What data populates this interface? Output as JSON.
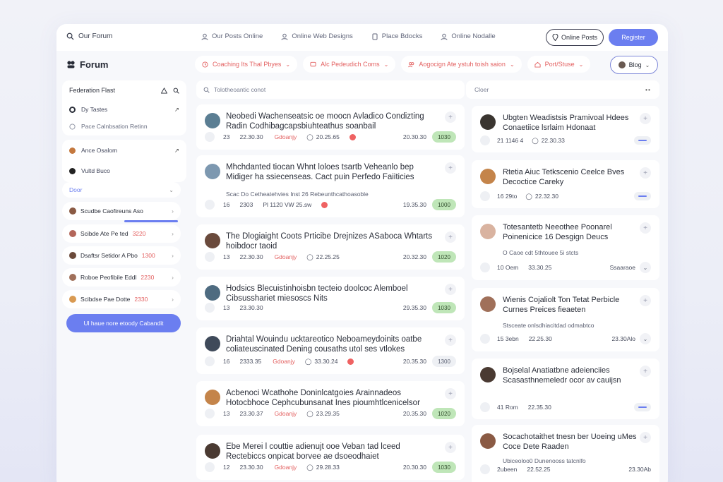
{
  "topbar": {
    "brand": "Our Forum",
    "nav": [
      "Our Posts Online",
      "Online Web Designs",
      "Place Bdocks",
      "Online Nodalle"
    ],
    "outline_btn": "Online Posts",
    "primary_btn": "Register"
  },
  "page": {
    "title": "Forum"
  },
  "filters": [
    {
      "label": "Coaching Its Thal Pbyes"
    },
    {
      "label": "Alc Pedeudich Coms"
    },
    {
      "label": "Aogocign Ate ystuh toish saion"
    },
    {
      "label": "Port/Stuse"
    }
  ],
  "blog_btn": "Blog",
  "sidebar": {
    "header": "Federation Flast",
    "row1": "Dy Tastes",
    "row1_sub": "Pace Calnbsation Retinn",
    "row2": "Ance Osalom",
    "row3": "Vultd Buco",
    "section": "Door",
    "items": [
      {
        "label": "Scudbe Caofireuns Aso",
        "num": ""
      },
      {
        "label": "Scibde Ate Pe ted",
        "num": "3220"
      },
      {
        "label": "Dsaftsr Setidor A Pbo",
        "num": "1300"
      },
      {
        "label": "Roboe Peofibile Eddl",
        "num": "2230"
      },
      {
        "label": "Scibdse Pae Dotte",
        "num": "2330"
      }
    ],
    "cta": "Ul haue nore etoody Cabandit"
  },
  "search": {
    "placeholder": "Tolotheoantic conot"
  },
  "posts": [
    {
      "title": "Neobedi Wachenseatsic oe moocn Avladico Condizting Radin Codhibagcapsbiuhteathus soanbail",
      "sub": "",
      "m1": "23",
      "m2": "22.30.30",
      "tag": "Gdoanjy",
      "m3": "20.25.65",
      "m4": "20.30.30",
      "pill": "1030",
      "pill_style": "green"
    },
    {
      "title": "Mhchdanted tiocan Whnt loloes tsartb Veheanlo bep Midiger ha ssiecenseas. Cact puin Perfedo Faiiticies",
      "sub": "Scac Do Cetheatehvies Inst 26 Rebeunthcathoasoble",
      "m1": "16",
      "m2": "2303",
      "tag": "",
      "m3": "Pl  1120  VW  25.sw",
      "m4": "19.35.30",
      "pill": "1000",
      "pill_style": "green"
    },
    {
      "title": "The Dlogiaight Coots Prticibe Drejnizes ASaboca Whtarts hoibdocr taoid",
      "sub": "",
      "m1": "13",
      "m2": "22.30.30",
      "tag": "Gdoanjy",
      "m3": "22.25.25",
      "m4": "20.32.30",
      "pill": "1020",
      "pill_style": "green"
    },
    {
      "title": "Hodsics Blecuistinhoisbn tecteio doolcoc Alemboel Cibsusshariet miesoscs Nits",
      "sub": "",
      "m1": "13",
      "m2": "23.30.30",
      "tag": "",
      "m3": "",
      "m4": "29.35.30",
      "pill": "1030",
      "pill_style": "green"
    },
    {
      "title": "Driahtal Wouindu ucktareotico Neboameydoinits oatbe coliateuscinated Dening cousaths utol ses vtlokes",
      "sub": "",
      "m1": "16",
      "m2": "2333.35",
      "tag": "Gdoanjy",
      "m3": "33.30.24",
      "m4": "20.35.30",
      "pill": "1300",
      "pill_style": "grey"
    },
    {
      "title": "Acbenoci Wcathohe Doninlcatgoies Arainnadeos Hotocbhoce Cephcubunsanat Ines pioumhtlcenicelsor",
      "sub": "",
      "m1": "13",
      "m2": "23.30.37",
      "tag": "Gdoanjy",
      "m3": "23.29.35",
      "m4": "20.35.30",
      "pill": "1020",
      "pill_style": "green"
    },
    {
      "title": "Ebe Merei l couttie adienujt ooe Veban tad lceed Rectebiccs onpicat borvee ae dsoeodhaiet",
      "sub": "",
      "m1": "12",
      "m2": "23.30.30",
      "tag": "Gdoanjy",
      "m3": "29.28.33",
      "m4": "20.30.30",
      "pill": "1030",
      "pill_style": "green"
    }
  ],
  "right_head": "Cloer",
  "rposts": [
    {
      "title": "Ubgten Weadistsis Pramivoal Hdees Conaetiice lsrlaim Hdonaat",
      "sub": "",
      "m1": "21 1146 4",
      "m2": "22.30.33",
      "end": "bar"
    },
    {
      "title": "Rtetia Aiuc Tetkscenio Ceelce Bves Decoctice Careky",
      "sub": "",
      "m1": "16 29to",
      "m2": "22.32.30",
      "end": "bar"
    },
    {
      "title": "Totesantetb Neeothee Poonarel Poinenicice 16 Desgign Deucs",
      "sub": "O Caoe cdt 5thtouee 5i stcts",
      "m1": "10 Oem",
      "m2": "33.30.25",
      "end": "Ssaaraoe"
    },
    {
      "title": "Wienis Cojaliolt Ton Tetat Perbicle Curnes Preices fieaeten",
      "sub": "Stsceate onlsdhiacitdad odmabtco",
      "m1": "15 3ebn",
      "m2": "22.25.30",
      "end": "23.30Alo"
    },
    {
      "title": "Bojselal Anatiatbne adeienciies Scasasthnemeledr ocor av cauijsn",
      "sub": "",
      "m1": "41 Rom",
      "m2": "22.35.30",
      "end": "bar"
    },
    {
      "title": "Socachotaithet tnesn ber Uoeing uMes Coce Dete Raaden",
      "sub": "Ubiceoloo0 Dunenooss tatcnlfo",
      "m1": "2ubeen",
      "m2": "22.52.25",
      "end": "23.30Ab"
    }
  ]
}
